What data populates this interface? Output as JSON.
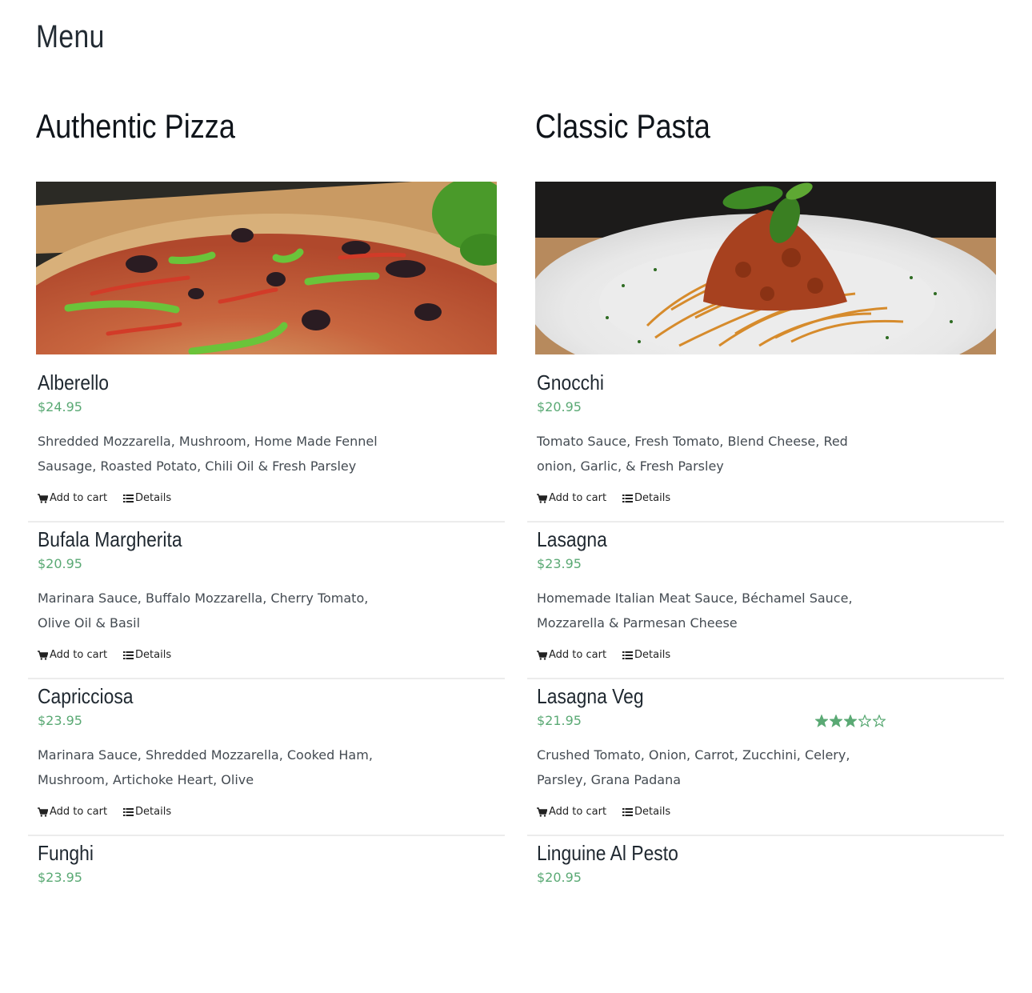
{
  "page": {
    "title": "Menu"
  },
  "columns": [
    {
      "title": "Authentic Pizza",
      "image_alt": "pizza photo",
      "items": [
        {
          "name": "Alberello",
          "price": "$24.95",
          "desc_lines": [
            "Shredded Mozzarella, Mushroom, Home Made Fennel",
            "Sausage, Roasted Potato, Chili Oil & Fresh Parsley"
          ],
          "add_to_cart": "Add to cart",
          "details": "Details"
        },
        {
          "name": "Bufala Margherita",
          "price": "$20.95",
          "desc_lines": [
            "Marinara Sauce, Buffalo Mozzarella, Cherry Tomato,",
            "Olive Oil & Basil"
          ],
          "add_to_cart": "Add to cart",
          "details": "Details"
        },
        {
          "name": "Capricciosa",
          "price": "$23.95",
          "desc_lines": [
            "Marinara Sauce, Shredded Mozzarella, Cooked Ham,",
            "Mushroom, Artichoke Heart, Olive"
          ],
          "add_to_cart": "Add to cart",
          "details": "Details"
        },
        {
          "name": "Funghi",
          "price": "$23.95"
        }
      ]
    },
    {
      "title": "Classic Pasta",
      "image_alt": "pasta photo",
      "items": [
        {
          "name": "Gnocchi",
          "price": "$20.95",
          "desc_lines": [
            "Tomato Sauce, Fresh Tomato, Blend Cheese, Red",
            "onion, Garlic, & Fresh Parsley"
          ],
          "add_to_cart": "Add to cart",
          "details": "Details"
        },
        {
          "name": "Lasagna",
          "price": "$23.95",
          "desc_lines": [
            "Homemade Italian Meat Sauce, Béchamel Sauce,",
            "Mozzarella & Parmesan Cheese"
          ],
          "add_to_cart": "Add to cart",
          "details": "Details"
        },
        {
          "name": "Lasagna Veg",
          "price": "$21.95",
          "rating": 3,
          "rating_max": 5,
          "desc_lines": [
            "Crushed Tomato, Onion, Carrot, Zucchini, Celery,",
            "Parsley, Grana Padana"
          ],
          "add_to_cart": "Add to cart",
          "details": "Details"
        },
        {
          "name": "Linguine Al Pesto",
          "price": "$20.95"
        }
      ]
    }
  ],
  "icons": {
    "cart": "cart-icon",
    "details": "list-icon",
    "star_full": "star-filled-icon",
    "star_empty": "star-empty-icon"
  },
  "colors": {
    "price": "#5aa974",
    "star": "#5aa974",
    "divider": "#ececec",
    "heading": "#0f141a"
  }
}
